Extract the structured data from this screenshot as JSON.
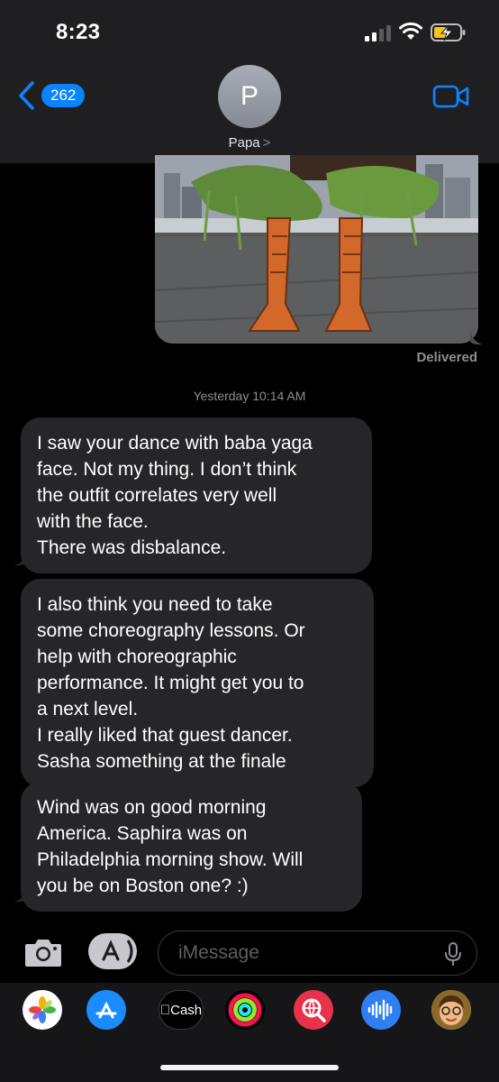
{
  "status_bar": {
    "time": "8:23"
  },
  "nav": {
    "back_badge": "262",
    "avatar_initial": "P",
    "contact_name": "Papa",
    "contact_chevron": ">"
  },
  "thread": {
    "delivered_label": "Delivered",
    "timestamp": "Yesterday 10:14 AM",
    "messages": [
      {
        "lines": [
          "I saw your dance with baba yaga",
          "face. Not my thing. I don’t think",
          "the outfit correlates very well",
          "with the face.",
          "There was disbalance."
        ]
      },
      {
        "lines": [
          "I also think you need to take",
          "some choreography lessons. Or",
          "help with choreographic",
          "performance.  It might get you to",
          "a next level.",
          "I really liked that guest dancer.",
          "Sasha something at the finale"
        ]
      },
      {
        "lines": [
          "Wind was on good morning",
          "America. Saphira was on",
          "Philadelphia morning show. Will",
          "you be on Boston one? :)"
        ]
      }
    ]
  },
  "composer": {
    "placeholder": "iMessage"
  },
  "app_drawer": {
    "apps": [
      {
        "name": "photos",
        "label": ""
      },
      {
        "name": "app-store",
        "label": ""
      },
      {
        "name": "cash",
        "label": "Cash"
      },
      {
        "name": "activity",
        "label": ""
      },
      {
        "name": "image-search",
        "label": ""
      },
      {
        "name": "audio",
        "label": ""
      },
      {
        "name": "memoji",
        "label": ""
      }
    ]
  },
  "colors": {
    "accent": "#0a84ff",
    "bubble_incoming": "#262628",
    "header": "#1f1f21"
  }
}
